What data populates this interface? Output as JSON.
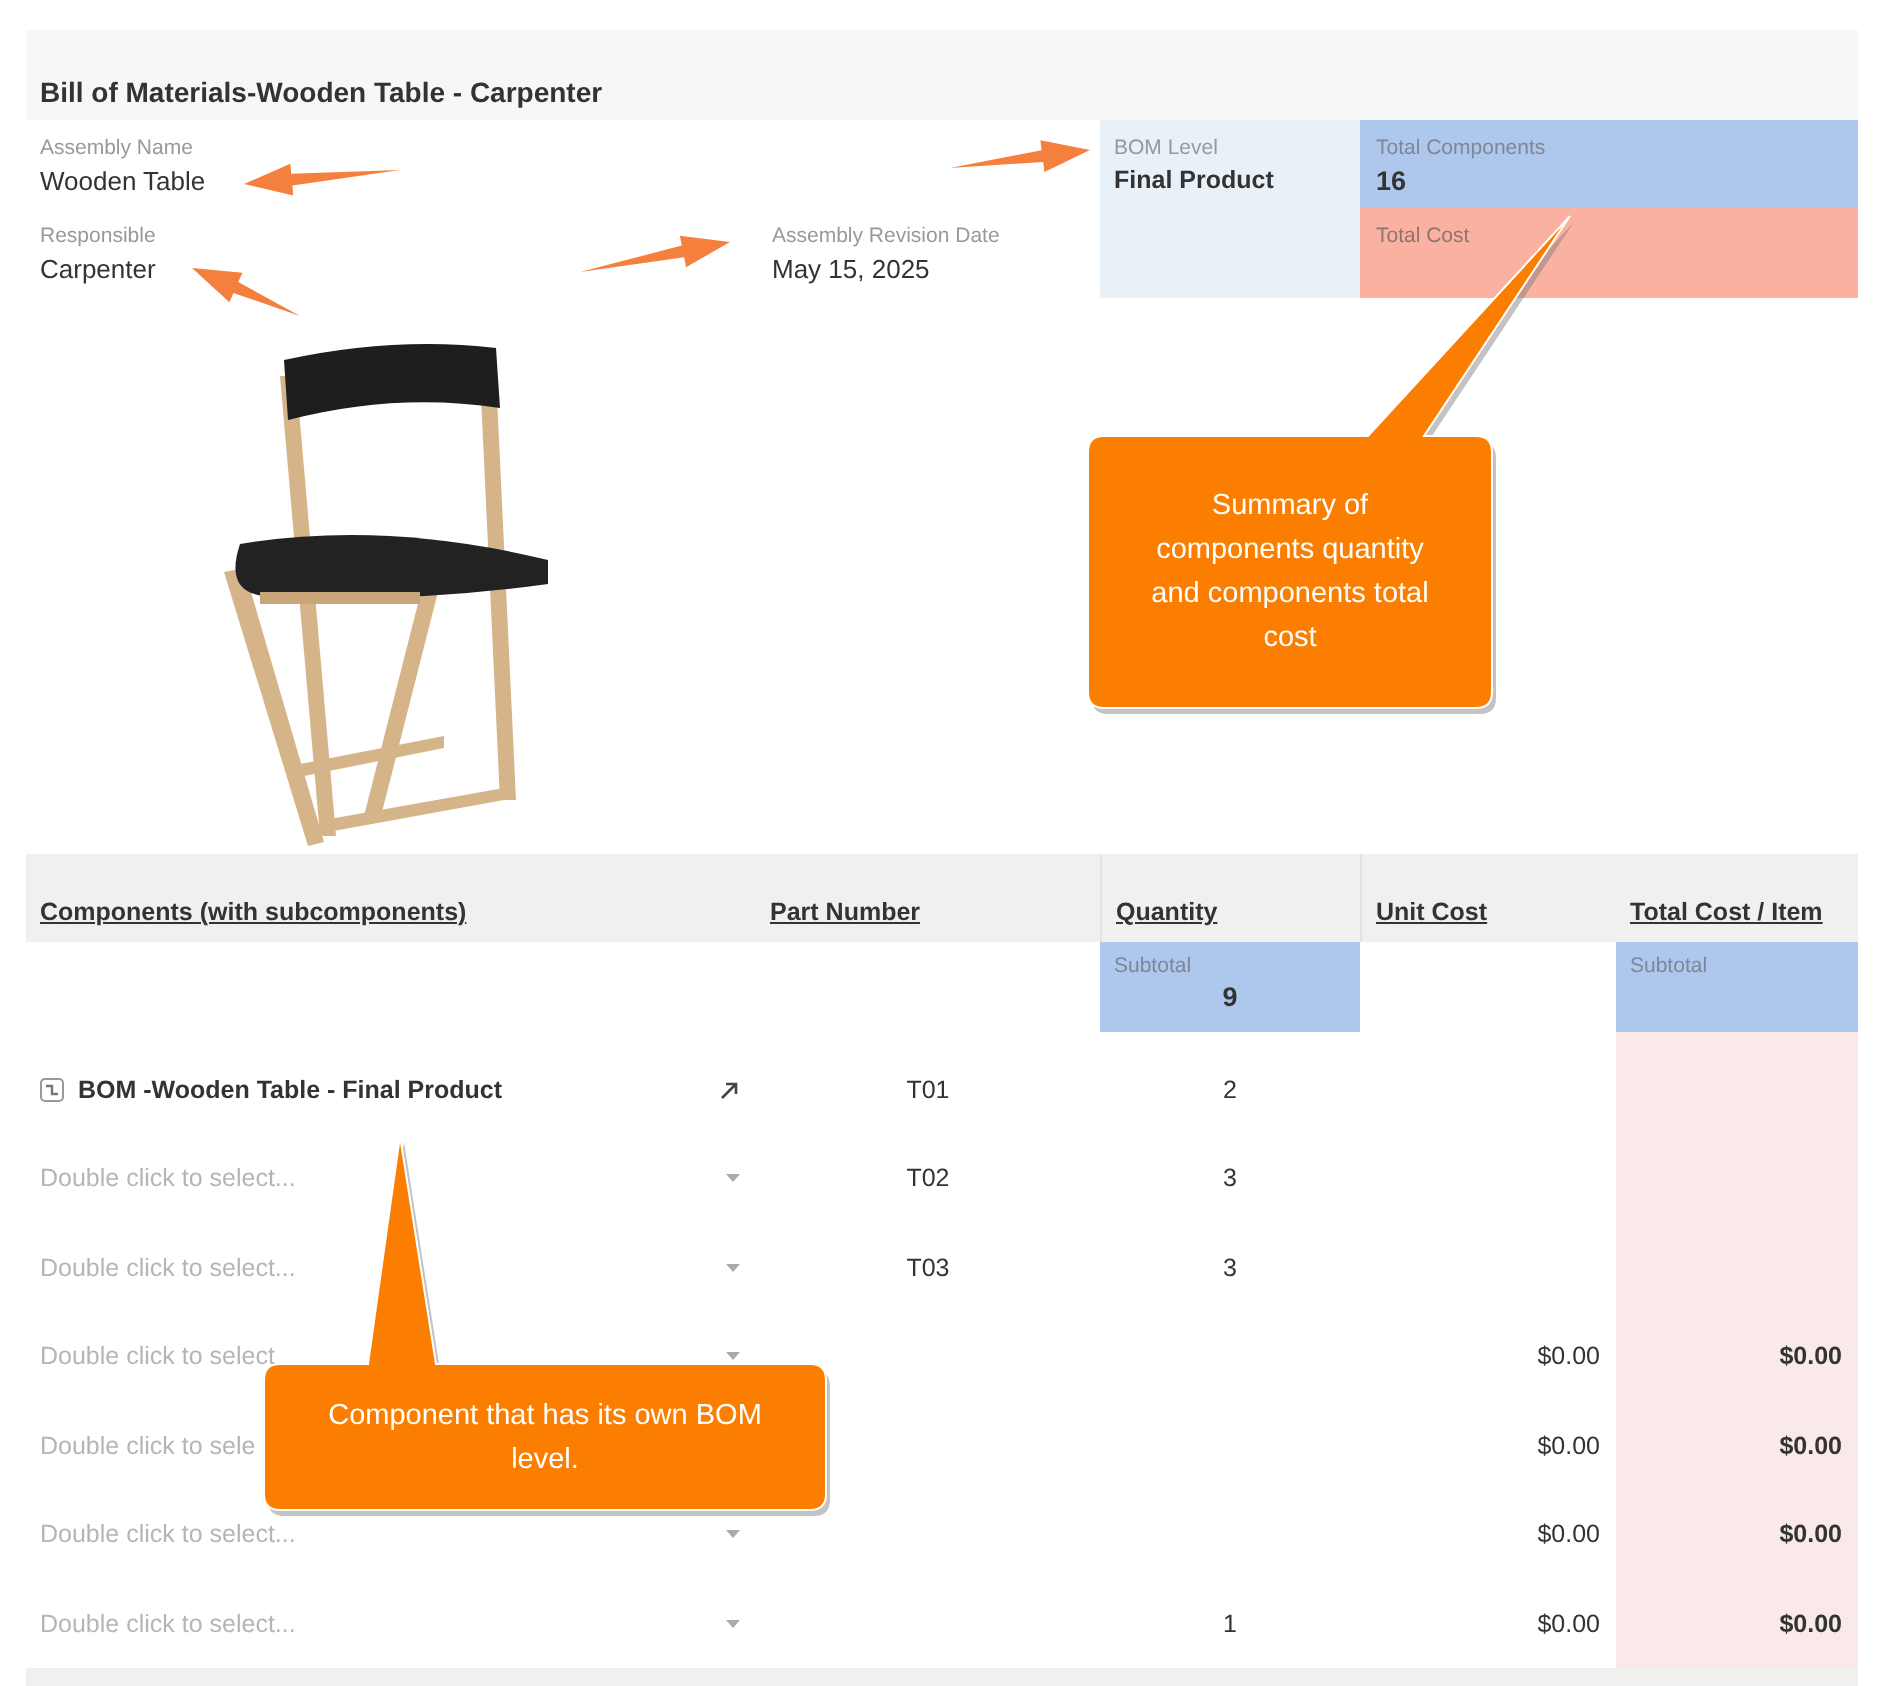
{
  "title": "Bill of Materials-Wooden Table - Carpenter",
  "fields": [
    {
      "label": "Assembly Name",
      "value": "Wooden Table"
    },
    {
      "label": "Responsible",
      "value": "Carpenter"
    },
    {
      "label": "Assembly Revision Date",
      "value": "May 15, 2025"
    }
  ],
  "bom_level": {
    "label": "BOM Level",
    "value": "Final Product"
  },
  "total_components": {
    "label": "Total Components",
    "value": "16"
  },
  "total_cost": {
    "label": "Total Cost"
  },
  "table": {
    "columns": [
      "Components (with subcomponents)",
      "Part Number",
      "Quantity",
      "Unit Cost",
      "Total Cost / Item"
    ],
    "subtotals": {
      "quantity": {
        "label": "Subtotal",
        "value": "9"
      },
      "total_cost_item": {
        "label": "Subtotal"
      }
    },
    "rows": [
      {
        "kind": "linked",
        "component": "BOM -Wooden Table - Final Product",
        "part_number": "T01",
        "quantity": "2"
      },
      {
        "kind": "select",
        "component": "Double click to select...",
        "caret": true,
        "part_number": "T02",
        "quantity": "3"
      },
      {
        "kind": "select",
        "component": "Double click to select...",
        "caret": true,
        "part_number": "T03",
        "quantity": "3"
      },
      {
        "kind": "select",
        "component": "Double click to select",
        "caret": true,
        "unit_cost": "$0.00",
        "total_cost": "$0.00"
      },
      {
        "kind": "select",
        "component": "Double click to sele",
        "caret": false,
        "unit_cost": "$0.00",
        "total_cost": "$0.00"
      },
      {
        "kind": "select",
        "component": "Double click to select...",
        "caret": true,
        "unit_cost": "$0.00",
        "total_cost": "$0.00"
      },
      {
        "kind": "select",
        "component": "Double click to select...",
        "caret": true,
        "quantity": "1",
        "unit_cost": "$0.00",
        "total_cost": "$0.00"
      }
    ]
  },
  "callouts": [
    {
      "text": "Summary of components quantity and components total cost"
    },
    {
      "text": "Component that has its own BOM level."
    }
  ]
}
